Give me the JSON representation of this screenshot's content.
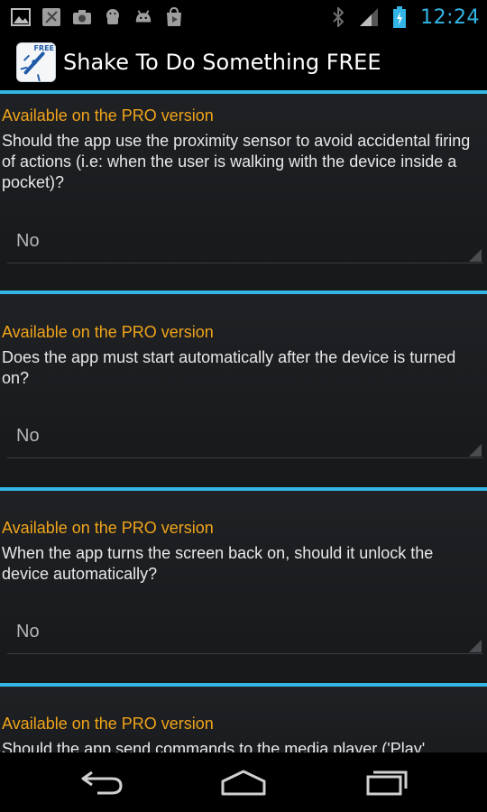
{
  "status_bar": {
    "time": "12:24",
    "left_icons": [
      "gallery-icon",
      "app-notification-icon",
      "camera-icon",
      "android-icon",
      "android-icon",
      "play-store-icon"
    ],
    "right_icons": [
      "bluetooth-icon",
      "signal-icon",
      "battery-icon"
    ]
  },
  "action_bar": {
    "title": "Shake To Do Something FREE",
    "icon_badge": "FREE"
  },
  "settings": [
    {
      "pro_label": "Available on the PRO version",
      "question": "Should the app use the proximity sensor to avoid accidental firing of actions (i.e: when the user is walking with the device inside a pocket)?",
      "value": "No"
    },
    {
      "pro_label": "Available on the PRO version",
      "question": "Does the app must start automatically after the device is turned on?",
      "value": "No"
    },
    {
      "pro_label": "Available on the PRO version",
      "question": "When the app turns the screen back on, should it unlock the device automatically?",
      "value": "No"
    },
    {
      "pro_label": "Available on the PRO version",
      "question": "Should the app send commands to the media player ('Play'",
      "value": ""
    }
  ],
  "nav_bar": {
    "buttons": [
      "back-icon",
      "home-icon",
      "recents-icon"
    ]
  },
  "colors": {
    "accent": "#33b5e5",
    "pro_label": "#f0a41b",
    "background": "#1a1c1e"
  }
}
